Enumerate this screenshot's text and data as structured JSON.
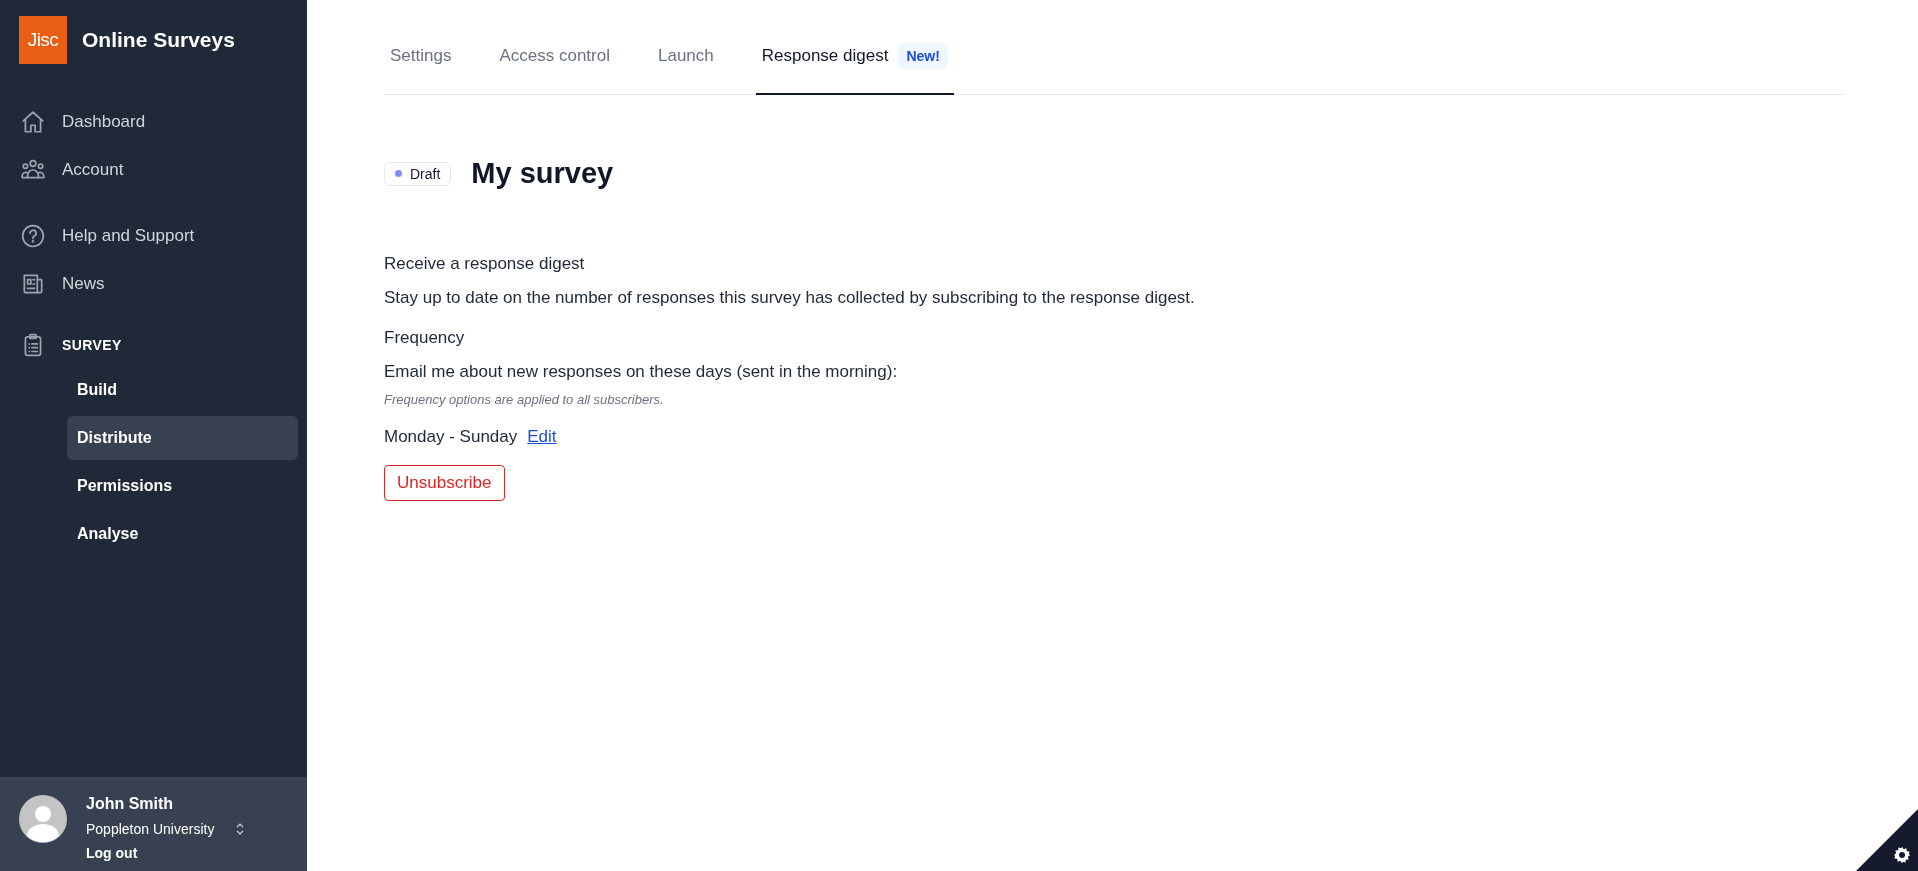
{
  "sidebar": {
    "logo": "Jisc",
    "title": "Online Surveys",
    "nav_groups": [
      [
        {
          "label": "Dashboard"
        },
        {
          "label": "Account"
        }
      ],
      [
        {
          "label": "Help and Support"
        },
        {
          "label": "News"
        }
      ]
    ],
    "survey_section": {
      "label": "SURVEY",
      "items": [
        {
          "label": "Build",
          "selected": false
        },
        {
          "label": "Distribute",
          "selected": true
        },
        {
          "label": "Permissions",
          "selected": false
        },
        {
          "label": "Analyse",
          "selected": false
        }
      ]
    },
    "user": {
      "name": "John Smith",
      "organisation": "Poppleton University",
      "logout": "Log out"
    }
  },
  "tabs": [
    {
      "label": "Settings",
      "selected": false
    },
    {
      "label": "Access control",
      "selected": false
    },
    {
      "label": "Launch",
      "selected": false
    },
    {
      "label": "Response digest",
      "selected": true,
      "badge": "New!"
    }
  ],
  "status": {
    "label": "Draft",
    "color": "#818cf8"
  },
  "survey_title": "My survey",
  "digest": {
    "heading": "Receive a response digest",
    "description": "Stay up to date on the number of responses this survey has collected by subscribing to the response digest.",
    "frequency_heading": "Frequency",
    "frequency_prompt": "Email me about new responses on these days (sent in the morning):",
    "frequency_note": "Frequency options are applied to all subscribers.",
    "days": "Monday - Sunday",
    "edit_link": "Edit",
    "unsubscribe": "Unsubscribe"
  }
}
